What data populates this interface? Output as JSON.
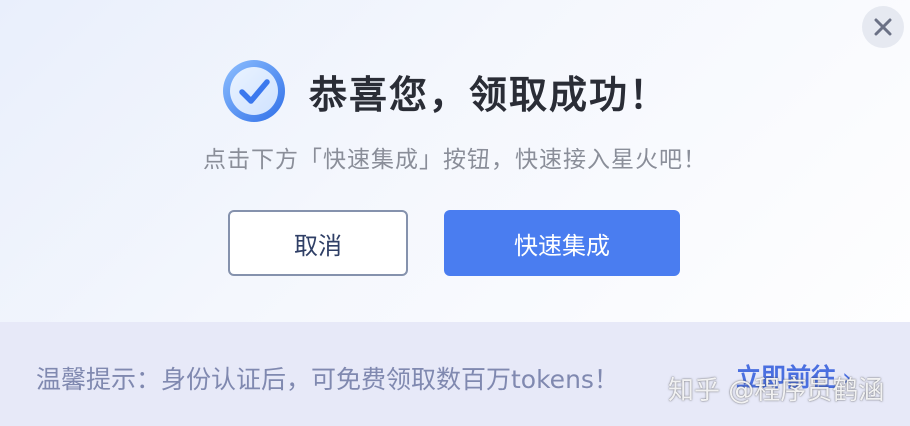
{
  "dialog": {
    "title": "恭喜您，领取成功！",
    "subtitle": "点击下方「快速集成」按钮，快速接入星火吧！",
    "cancel_label": "取消",
    "primary_label": "快速集成",
    "close_icon": "close-icon",
    "success_icon": "check-circle-icon"
  },
  "footer": {
    "tip": "温馨提示：身份认证后，可免费领取数百万tokens！",
    "link_label": "立即前往",
    "link_arrow": "›"
  },
  "watermark": {
    "text": "知乎 @程序员鹤涵"
  },
  "colors": {
    "primary": "#4a7df0",
    "title": "#2a2d36",
    "subtitle": "#8a8e99",
    "footer_bg": "#e7e9f8",
    "link": "#4a6fe0"
  }
}
